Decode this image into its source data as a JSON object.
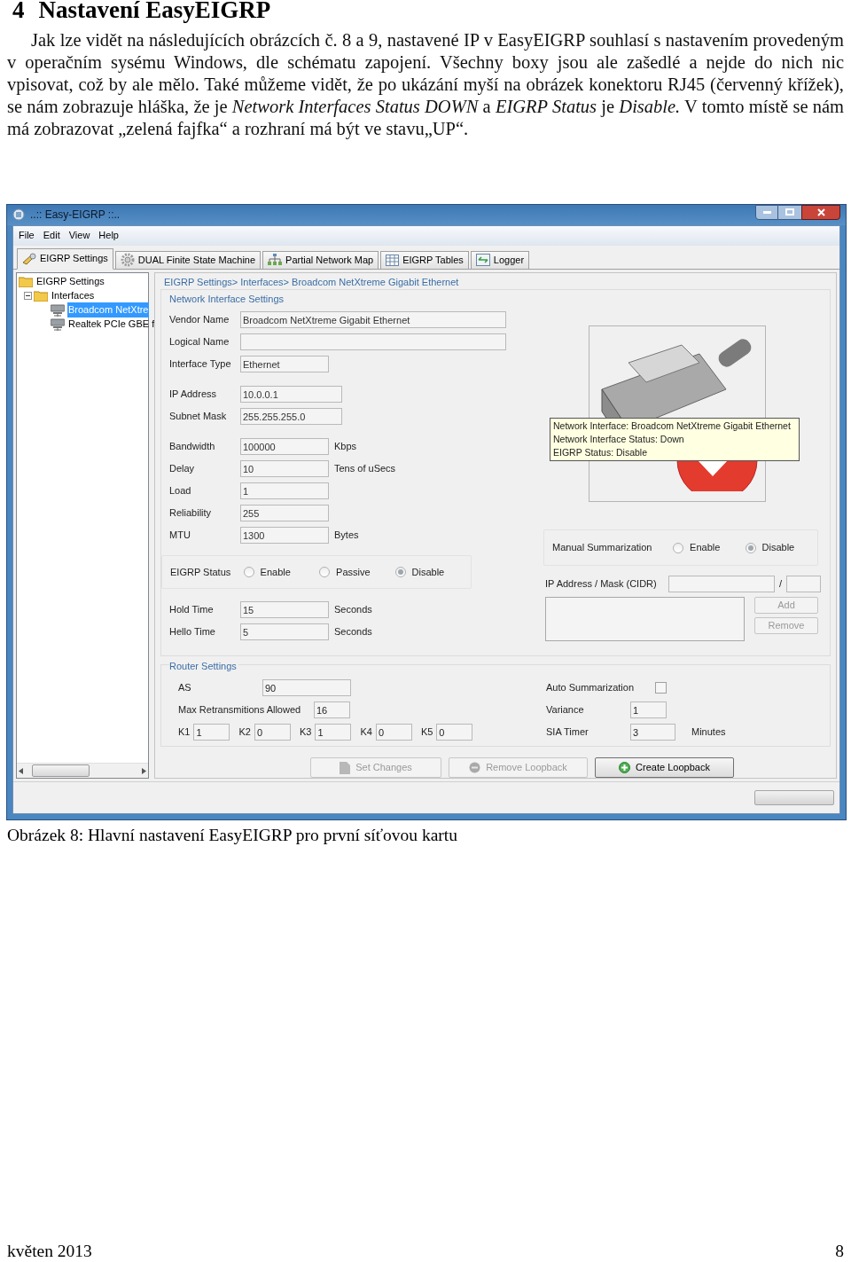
{
  "heading": {
    "number": "4",
    "title": "Nastavení EasyEIGRP"
  },
  "paragraph": "Jak lze vidět na následujících obrázcích č. 8 a 9, nastavené IP v EasyEIGRP souhlasí s nastavením provedeným v operačním sysému Windows, dle schématu zapojení. Všechny boxy jsou ale zašedlé a nejde do nich nic vpisovat, což by ale mělo. Také můžeme vidět, že po ukázání myší na obrázek konektoru RJ45 (červenný křížek), se nám zobrazuje hláška, že je *Network Interfaces Status DOWN* a *EIGRP Status* je *Disable.* V tomto místě se nám má zobrazovat „zelená fajfka“ a rozhraní má být ve stavu„UP“.",
  "window": {
    "title": "..:: Easy-EIGRP ::..",
    "menu": [
      "File",
      "Edit",
      "View",
      "Help"
    ],
    "tabs": [
      {
        "label": "EIGRP Settings",
        "selected": true
      },
      {
        "label": "DUAL Finite State Machine",
        "selected": false
      },
      {
        "label": "Partial Network Map",
        "selected": false
      },
      {
        "label": "EIGRP Tables",
        "selected": false
      },
      {
        "label": "Logger",
        "selected": false
      }
    ],
    "tree": [
      {
        "label": "EIGRP Settings",
        "kind": "folder",
        "selected": false,
        "children": [
          {
            "label": "Interfaces",
            "kind": "folder",
            "expanded": true,
            "selected": false,
            "children": [
              {
                "label": "Broadcom NetXtre",
                "kind": "nic",
                "selected": true
              },
              {
                "label": "Realtek PCIe GBE f",
                "kind": "nic",
                "selected": false
              }
            ]
          }
        ]
      }
    ],
    "breadcrumb": "EIGRP Settings> Interfaces> Broadcom NetXtreme Gigabit Ethernet",
    "interface_section": {
      "title": "Network Interface Settings",
      "field_groups": [
        [
          {
            "label": "Vendor Name",
            "value": "Broadcom NetXtreme Gigabit Ethernet",
            "kind": "wide"
          },
          {
            "label": "Logical Name",
            "kind": "wide"
          },
          {
            "label": "Interface Type",
            "value": "Ethernet",
            "kind": "short"
          }
        ],
        [
          {
            "label": "IP Address",
            "value": "10.0.0.1",
            "kind": "medium"
          },
          {
            "label": "Subnet Mask",
            "value": "255.255.255.0",
            "kind": "medium"
          }
        ],
        [
          {
            "label": "Bandwidth",
            "value": "100000",
            "unit": "Kbps",
            "kind": "short"
          },
          {
            "label": "Delay",
            "value": "10",
            "unit": "Tens of uSecs",
            "kind": "short"
          },
          {
            "label": "Load",
            "value": "1",
            "kind": "short"
          },
          {
            "label": "Reliability",
            "value": "255",
            "kind": "short"
          },
          {
            "label": "MTU",
            "value": "1300",
            "unit": "Bytes",
            "kind": "short"
          }
        ]
      ],
      "eigrp_status": {
        "label": "EIGRP Status",
        "options": [
          {
            "label": "Enable",
            "selected": false
          },
          {
            "label": "Passive",
            "selected": false
          },
          {
            "label": "Disable",
            "selected": true
          }
        ]
      },
      "timers": [
        {
          "label": "Hold Time",
          "value": "15",
          "unit": "Seconds"
        },
        {
          "label": "Hello Time",
          "value": "5",
          "unit": "Seconds"
        }
      ],
      "tooltip": [
        "Network Interface: Broadcom NetXtreme Gigabit Ethernet",
        "Network Interface Status: Down",
        "EIGRP Status: Disable"
      ],
      "manual_summarization": {
        "label": "Manual Summarization",
        "options": [
          {
            "label": "Enable",
            "selected": false
          },
          {
            "label": "Disable",
            "selected": true
          }
        ]
      },
      "cidr": {
        "label": "IP Address / Mask (CIDR)",
        "separator": "/"
      },
      "cidr_buttons": [
        {
          "label": "Add",
          "disabled": true
        },
        {
          "label": "Remove",
          "disabled": true
        }
      ]
    },
    "router_section": {
      "title": "Router Settings",
      "as": {
        "label": "AS",
        "value": "90"
      },
      "max_retransmissions": {
        "label": "Max Retransmitions Allowed",
        "value": "16"
      },
      "k_values": [
        {
          "label": "K1",
          "value": "1"
        },
        {
          "label": "K2",
          "value": "0"
        },
        {
          "label": "K3",
          "value": "1"
        },
        {
          "label": "K4",
          "value": "0"
        },
        {
          "label": "K5",
          "value": "0"
        }
      ],
      "auto_summarization": {
        "label": "Auto Summarization",
        "checked": false
      },
      "variance": {
        "label": "Variance",
        "value": "1"
      },
      "sia_timer": {
        "label": "SIA Timer",
        "value": "3",
        "unit": "Minutes"
      }
    },
    "buttons": [
      {
        "label": "Set Changes",
        "disabled": true
      },
      {
        "label": "Remove Loopback",
        "disabled": true
      },
      {
        "label": "Create Loopback",
        "disabled": false
      }
    ]
  },
  "caption": "Obrázek 8: Hlavní nastavení EasyEIGRP pro první síťovou kartu",
  "footer": {
    "date": "květen 2013",
    "page": "8"
  }
}
